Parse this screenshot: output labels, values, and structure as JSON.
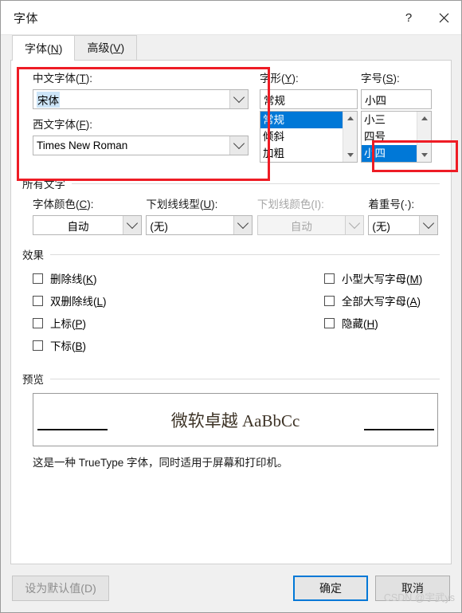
{
  "window": {
    "title": "字体",
    "help_icon": "question-mark-icon",
    "close_icon": "close-icon"
  },
  "tabs": [
    {
      "label": "字体(N)",
      "text": "字体(",
      "accel": "N",
      "tail": ")",
      "active": true
    },
    {
      "label": "高级(V)",
      "text": "高级(",
      "accel": "V",
      "tail": ")",
      "active": false
    }
  ],
  "font_section": {
    "chinese_font": {
      "label_text": "中文字体(",
      "label_accel": "T",
      "label_tail": "):",
      "value": "宋体",
      "selected": true
    },
    "latin_font": {
      "label_text": "西文字体(",
      "label_accel": "F",
      "label_tail": "):",
      "value": "Times New Roman",
      "selected": false
    },
    "font_style": {
      "label_text": "字形(",
      "label_accel": "Y",
      "label_tail": "):",
      "value": "常规",
      "options": [
        "常规",
        "倾斜",
        "加粗"
      ],
      "selected_index": 0
    },
    "font_size": {
      "label_text": "字号(",
      "label_accel": "S",
      "label_tail": "):",
      "value": "小四",
      "options": [
        "小三",
        "四号",
        "小四"
      ],
      "selected_index": 2
    }
  },
  "all_text_group": {
    "title": "所有文字",
    "font_color": {
      "label_text": "字体颜色(",
      "label_accel": "C",
      "label_tail": "):",
      "value": "自动",
      "disabled": false
    },
    "underline_style": {
      "label_text": "下划线线型(",
      "label_accel": "U",
      "label_tail": "):",
      "value": "(无)",
      "disabled": false
    },
    "underline_color": {
      "label_text": "下划线颜色(",
      "label_accel": "I",
      "label_tail": "):",
      "value": "自动",
      "disabled": true
    },
    "emphasis_mark": {
      "label_text": "着重号(",
      "label_accel": "·",
      "label_tail": "):",
      "value": "(无)",
      "disabled": false
    }
  },
  "effects_group": {
    "title": "效果",
    "left_column": [
      {
        "text": "删除线(",
        "accel": "K",
        "tail": ")",
        "checked": false
      },
      {
        "text": "双删除线(",
        "accel": "L",
        "tail": ")",
        "checked": false
      },
      {
        "text": "上标(",
        "accel": "P",
        "tail": ")",
        "checked": false
      },
      {
        "text": "下标(",
        "accel": "B",
        "tail": ")",
        "checked": false
      }
    ],
    "right_column": [
      {
        "text": "小型大写字母(",
        "accel": "M",
        "tail": ")",
        "checked": false
      },
      {
        "text": "全部大写字母(",
        "accel": "A",
        "tail": ")",
        "checked": false
      },
      {
        "text": "隐藏(",
        "accel": "H",
        "tail": ")",
        "checked": false
      }
    ]
  },
  "preview_group": {
    "title": "预览",
    "sample_text": "微软卓越  AaBbCc",
    "note": "这是一种 TrueType 字体，同时适用于屏幕和打印机。"
  },
  "footer": {
    "set_default": {
      "text": "设为默认值(",
      "accel": "D",
      "tail": ")",
      "disabled": true
    },
    "ok": "确定",
    "cancel": "取消"
  },
  "watermark": "CSDN @宇武ys",
  "colors": {
    "accent": "#0078d7",
    "annotation": "#ee1c25",
    "selection_bg": "#cce4f7",
    "disabled_text": "#a6a6a6"
  }
}
